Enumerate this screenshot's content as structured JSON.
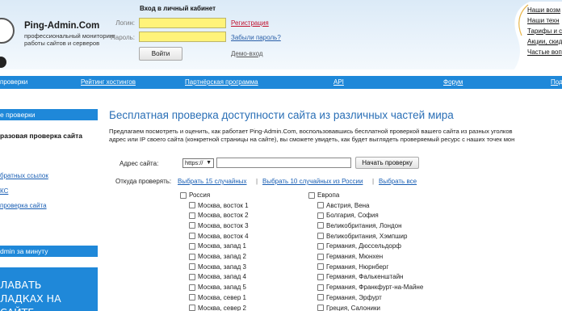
{
  "header": {
    "logo_title": "Ping-Admin.Com",
    "logo_sub": "профессиональный мониторинг работы сайтов и серверов",
    "login_title": "Вход в личный кабинет",
    "login_label": "Логин:",
    "password_label": "Пароль:",
    "register_link": "Регистрация",
    "forgot_link": "Забыли пароль?",
    "login_button": "Войти",
    "demo_link": "Демо-вход",
    "right_links": [
      "Наши возм",
      "Наши техн",
      "Тарифы и с",
      "Акции, скид",
      "Частые воп"
    ]
  },
  "nav": {
    "items": [
      "проверки",
      "Рейтинг хостингов",
      "Партнёрская программа",
      "API",
      "Форум",
      "Под"
    ]
  },
  "sidebar": {
    "head1": "е проверки",
    "item_active": "разовая проверка сайта",
    "links": [
      "братных ссылок",
      "КС",
      "проверка сайта"
    ],
    "head2": "dmin за минуту",
    "banner_line1": "ЛАВАТЬ",
    "banner_line2": "ЛАДКАХ НА САЙТЕ"
  },
  "main": {
    "title": "Бесплатная проверка доступности сайта из различных частей мира",
    "desc_line1": "Предлагаем посмотреть и оценить, как работает Ping-Admin.Com, воспользовавшись бесплатной проверкой вашего сайта из разных уголков",
    "desc_line2": "адрес или IP своего сайта (конкретной страницы на сайте), вы сможете увидеть, как будет выглядеть проверяемый ресурс с наших точек мон",
    "address_label": "Адрес сайта:",
    "protocol_value": "https://",
    "check_button": "Начать проверку",
    "from_label": "Откуда проверять:",
    "quick_links": [
      "Выбрать 15 случайных",
      "Выбрать 10 случайных из России",
      "Выбрать все"
    ]
  },
  "regions": {
    "russia": {
      "label": "Россия",
      "items": [
        "Москва, восток 1",
        "Москва, восток 2",
        "Москва, восток 3",
        "Москва, восток 4",
        "Москва, запад 1",
        "Москва, запад 2",
        "Москва, запад 3",
        "Москва, запад 4",
        "Москва, запад 5",
        "Москва, север 1",
        "Москва, север 2"
      ]
    },
    "europe": {
      "label": "Европа",
      "items": [
        "Австрия, Вена",
        "Болгария, София",
        "Великобритания, Лондон",
        "Великобритания, Хэмпшир",
        "Германия, Дюссельдорф",
        "Германия, Мюнхен",
        "Германия, Нюрнберг",
        "Германия, Фалькенштайн",
        "Германия, Франкфурт-на-Майне",
        "Германия, Эрфурт",
        "Греция, Салоники"
      ]
    }
  },
  "colors": {
    "accent": "#1f88d9",
    "title_blue": "#2a6fb6",
    "input_yellow": "#fff37a",
    "register_red": "#c0102c"
  }
}
